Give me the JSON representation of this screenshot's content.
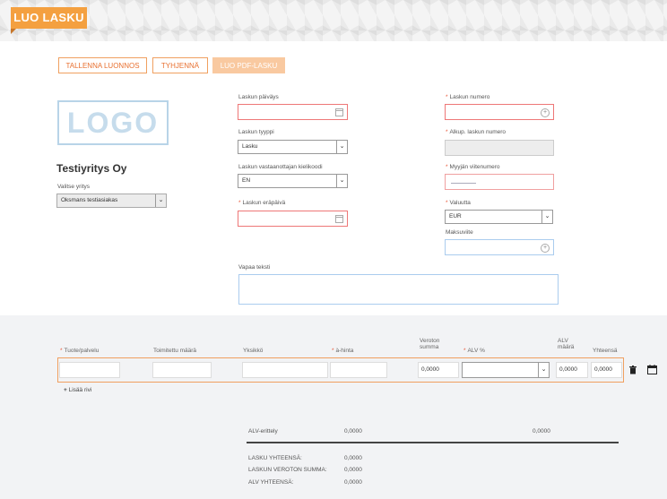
{
  "header": {
    "title": "LUO LASKU"
  },
  "toolbar": {
    "save_draft": "TALLENNA LUONNOS",
    "clear": "TYHJENNÄ",
    "create_pdf": "LUO PDF-LASKU"
  },
  "company": {
    "logo_text": "LOGO",
    "name": "Testiyritys Oy",
    "select_label": "Valitse yritys",
    "select_value": "Oksmans testiasiakas"
  },
  "form": {
    "invoice_date_label": "Laskun päiväys",
    "invoice_type_label": "Laskun tyyppi",
    "invoice_type_value": "Lasku",
    "language_label": "Laskun vastaanottajan kielikoodi",
    "language_value": "EN",
    "due_date_label": "Laskun eräpäivä",
    "invoice_number_label": "Laskun numero",
    "original_number_label": "Alkup. laskun numero",
    "seller_reference_label": "Myyjän viitenumero",
    "currency_label": "Valuutta",
    "currency_value": "EUR",
    "payment_ref_label": "Maksuviite",
    "free_text_label": "Vapaa teksti"
  },
  "table": {
    "columns": {
      "product": "Tuote/palvelu",
      "qty": "Toimitettu määrä",
      "unit": "Yksikkö",
      "unit_price": "à-hinta",
      "net_1": "Veroton",
      "net_2": "summa",
      "vat_pct": "ALV %",
      "vat_amt_1": "ALV",
      "vat_amt_2": "määrä",
      "total": "Yhteensä"
    },
    "row": {
      "net": "0,0000",
      "vat_amount": "0,0000",
      "total": "0,0000"
    },
    "add_row": "Lisää rivi"
  },
  "summary": {
    "vat_breakdown_label": "ALV-erittely",
    "vat_breakdown_value": "0,0000",
    "vat_breakdown_value2": "0,0000",
    "invoice_total_label": "LASKU YHTEENSÄ:",
    "invoice_total_value": "0,0000",
    "net_total_label": "LASKUN VEROTON SUMMA:",
    "net_total_value": "0,0000",
    "vat_total_label": "ALV YHTEENSÄ:",
    "vat_total_value": "0,0000"
  }
}
